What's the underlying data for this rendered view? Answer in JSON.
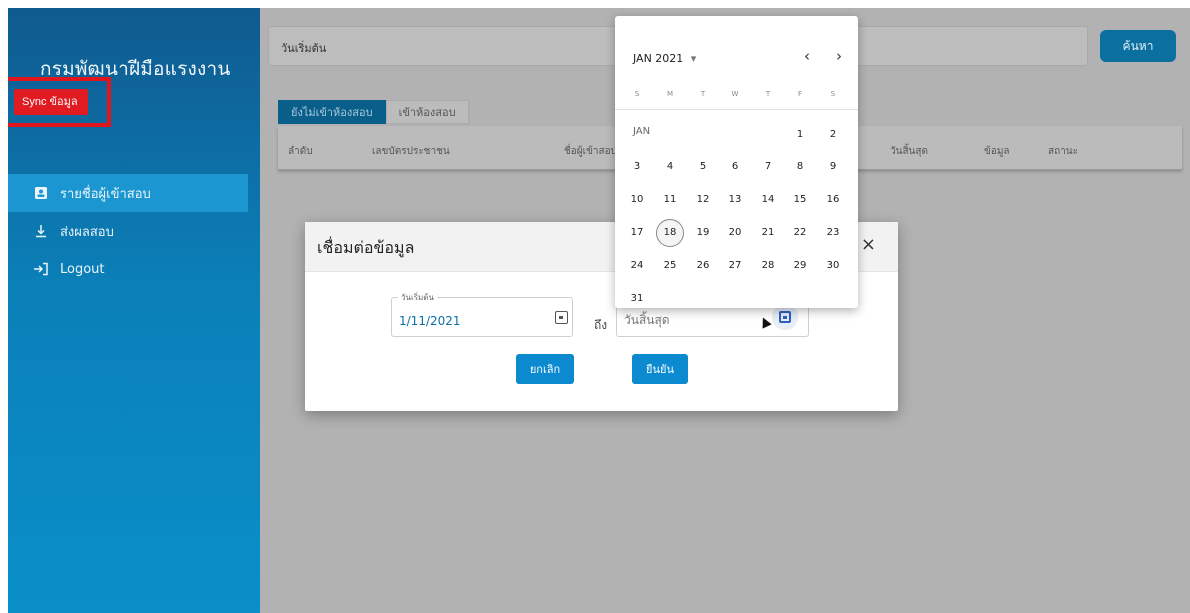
{
  "sidebar": {
    "title": "กรมพัฒนาฝีมือแรงงาน",
    "sync_label": "Sync ข้อมูล",
    "items": [
      {
        "label": "รายชื่อผู้เข้าสอบ",
        "icon": "id-card-icon"
      },
      {
        "label": "ส่งผลสอบ",
        "icon": "download-icon"
      },
      {
        "label": "Logout",
        "icon": "logout-icon"
      }
    ]
  },
  "search": {
    "start_label": "วันเริ่มต้น",
    "button": "ค้นหา"
  },
  "tabs": [
    "ยังไม่เข้าห้องสอบ",
    "เข้าห้องสอบ"
  ],
  "table": {
    "headers": [
      "ลำดับ",
      "เลขบัตรประชาชน",
      "ชื่อผู้เข้าสอบ",
      "วันสิ้นสุด",
      "ข้อมูล",
      "สถานะ"
    ]
  },
  "modal": {
    "title": "เชื่อมต่อข้อมูล",
    "close": "×",
    "start_label": "วันเริ่มต้น",
    "start_value": "1/11/2021",
    "to_label": "ถึง",
    "end_placeholder": "วันสิ้นสุด",
    "cancel": "ยกเลิก",
    "confirm": "ยืนยัน"
  },
  "datepicker": {
    "month_label": "JAN 2021",
    "dropdown": "▾",
    "prev": "‹",
    "next": "›",
    "weekdays": [
      "S",
      "M",
      "T",
      "W",
      "T",
      "F",
      "S"
    ],
    "month_short": "JAN",
    "selected_day": "18",
    "weeks": [
      [
        "",
        "",
        "",
        "",
        "",
        "1",
        "2"
      ],
      [
        "3",
        "4",
        "5",
        "6",
        "7",
        "8",
        "9"
      ],
      [
        "10",
        "11",
        "12",
        "13",
        "14",
        "15",
        "16"
      ],
      [
        "17",
        "18",
        "19",
        "20",
        "21",
        "22",
        "23"
      ],
      [
        "24",
        "25",
        "26",
        "27",
        "28",
        "29",
        "30"
      ],
      [
        "31",
        "",
        "",
        "",
        "",
        "",
        ""
      ]
    ]
  },
  "colors": {
    "sync_red": "#e11b22",
    "primary": "#0b8ad0",
    "sidebar_top": "#0f5a8e"
  }
}
